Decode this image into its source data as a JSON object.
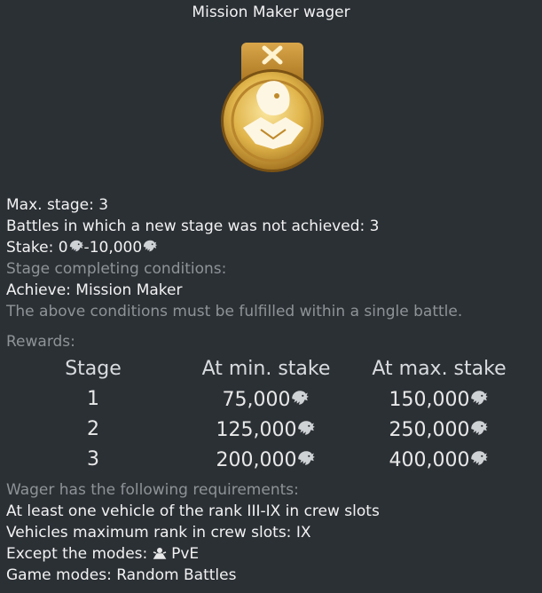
{
  "title": "Mission Maker wager",
  "info": {
    "max_stage_label": "Max. stage:",
    "max_stage_value": "3",
    "battles_label": "Battles in which a new stage was not achieved:",
    "battles_value": "3",
    "stake_label": "Stake:",
    "stake_min": "0",
    "stake_sep": "-",
    "stake_max": "10,000",
    "conditions_label": "Stage completing conditions:",
    "achieve_label": "Achieve:",
    "achieve_value": "Mission Maker",
    "single_battle_note": "The above conditions must be fulfilled within a single battle.",
    "rewards_label": "Rewards:"
  },
  "rewards": {
    "headers": [
      "Stage",
      "At min. stake",
      "At max. stake"
    ],
    "rows": [
      {
        "stage": "1",
        "min": "75,000",
        "max": "150,000"
      },
      {
        "stage": "2",
        "min": "125,000",
        "max": "250,000"
      },
      {
        "stage": "3",
        "min": "200,000",
        "max": "400,000"
      }
    ]
  },
  "requirements": {
    "heading": "Wager has the following requirements:",
    "rank_line": "At least one vehicle of the rank III-IX in crew slots",
    "max_rank_label": "Vehicles maximum rank in crew slots:",
    "max_rank_value": "IX",
    "except_label": "Except the modes:",
    "except_value": "PvE",
    "game_modes_label": "Game modes:",
    "game_modes_value": "Random Battles"
  },
  "icons": {
    "currency": "lion-eagle-icon",
    "pve": "pve-mode-icon",
    "medal": "mission-maker-medal"
  },
  "colors": {
    "background": "#2b3035",
    "text_primary": "#f2f2f2",
    "text_secondary": "#8e9398",
    "medal_gold": "#e0b44a",
    "medal_ribbon": "#c9902f"
  }
}
